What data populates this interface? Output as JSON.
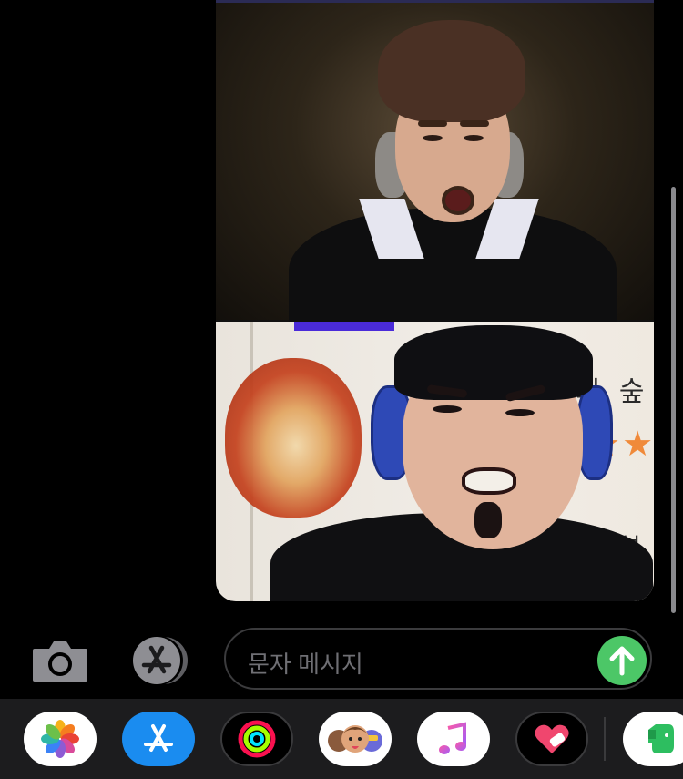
{
  "composer": {
    "placeholder": "문자 메시지"
  },
  "icons": {
    "camera": "camera-icon",
    "app_store": "app-store-icon",
    "send": "arrow-up-icon"
  },
  "app_drawer": {
    "apps": [
      {
        "name": "photos-app-icon"
      },
      {
        "name": "app-store-app-icon"
      },
      {
        "name": "fitness-rings-app-icon"
      },
      {
        "name": "memoji-app-icon"
      },
      {
        "name": "music-app-icon"
      },
      {
        "name": "digital-touch-app-icon"
      },
      {
        "name": "evernote-app-icon"
      }
    ]
  },
  "colors": {
    "send": "#4cc767",
    "app_store_blue": "#1a8cf0"
  }
}
